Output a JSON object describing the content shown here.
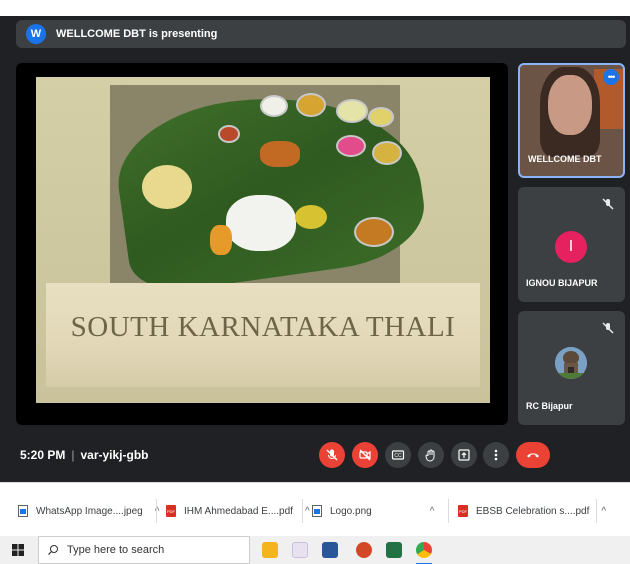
{
  "presenting": {
    "avatar_letter": "W",
    "text": "WELLCOME DBT is presenting"
  },
  "slide": {
    "title": "SOUTH KARNATAKA THALI"
  },
  "participants": [
    {
      "name": "WELLCOME DBT",
      "muted": false
    },
    {
      "name": "IGNOU BIJAPUR",
      "avatar_letter": "I",
      "avatar_color": "#e5215f",
      "muted": true
    },
    {
      "name": "RC Bijapur",
      "muted": true
    }
  ],
  "meeting": {
    "time": "5:20 PM",
    "separator": "|",
    "code": "var-yikj-gbb"
  },
  "controls": [
    {
      "name": "mic-off-button",
      "icon": "mic-off-icon",
      "style": "red"
    },
    {
      "name": "camera-off-button",
      "icon": "camera-off-icon",
      "style": "red"
    },
    {
      "name": "captions-button",
      "icon": "captions-icon",
      "style": "grey"
    },
    {
      "name": "raise-hand-button",
      "icon": "hand-icon",
      "style": "grey"
    },
    {
      "name": "present-button",
      "icon": "present-icon",
      "style": "grey"
    },
    {
      "name": "more-options-button",
      "icon": "more-vert-icon",
      "style": "grey"
    },
    {
      "name": "leave-call-button",
      "icon": "phone-hangup-icon",
      "style": "red"
    }
  ],
  "downloads": [
    {
      "label": "WhatsApp Image....jpeg",
      "icon": "image-file-icon"
    },
    {
      "label": "IHM Ahmedabad E....pdf",
      "icon": "pdf-file-icon"
    },
    {
      "label": "Logo.png",
      "icon": "image-file-icon"
    },
    {
      "label": "EBSB Celebration s....pdf",
      "icon": "pdf-file-icon"
    }
  ],
  "taskbar": {
    "search_placeholder": "Type here to search",
    "apps": [
      "file-explorer-icon",
      "paint-icon",
      "word-icon",
      "powerpoint-icon",
      "excel-icon",
      "chrome-icon"
    ]
  },
  "colors": {
    "meet_bg": "#202124",
    "tile_bg": "#3c4043",
    "danger": "#ea4335",
    "accent": "#1a73e8",
    "slide_title": "#6e6448"
  }
}
